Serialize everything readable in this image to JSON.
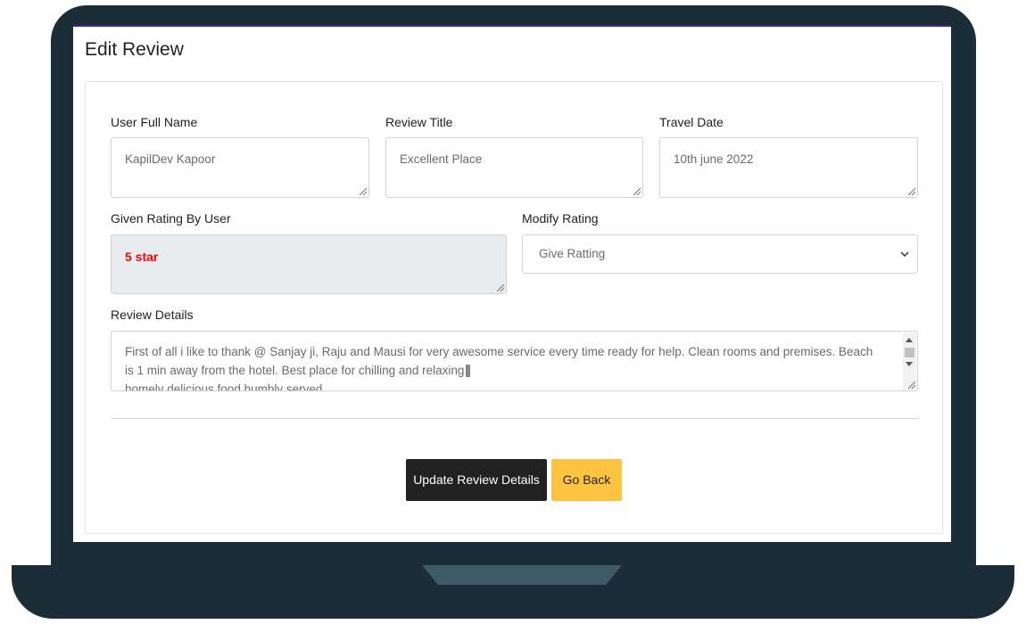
{
  "page": {
    "title": "Edit Review"
  },
  "form": {
    "user_full_name": {
      "label": "User Full Name",
      "value": "KapilDev Kapoor"
    },
    "review_title": {
      "label": "Review Title",
      "value": "Excellent Place"
    },
    "travel_date": {
      "label": "Travel Date",
      "value": "10th june 2022"
    },
    "given_rating": {
      "label": "Given Rating By User",
      "value": "5 star"
    },
    "modify_rating": {
      "label": "Modify Rating",
      "selected": "Give Ratting"
    },
    "review_details": {
      "label": "Review Details",
      "line1": "First of all i like to thank @ Sanjay ji, Raju and Mausi for very awesome service every time ready for help. Clean rooms and premises. Beach is 1 min away from the hotel. Best place for chilling and relaxing",
      "line2": "homely delicious food humbly served"
    }
  },
  "buttons": {
    "update_label": "Update Review Details",
    "back_label": "Go Back"
  },
  "colors": {
    "laptop_frame": "#1b2e38",
    "rating_text": "#ff0000",
    "primary_button": "#212121",
    "warning_button": "#ffc342"
  }
}
